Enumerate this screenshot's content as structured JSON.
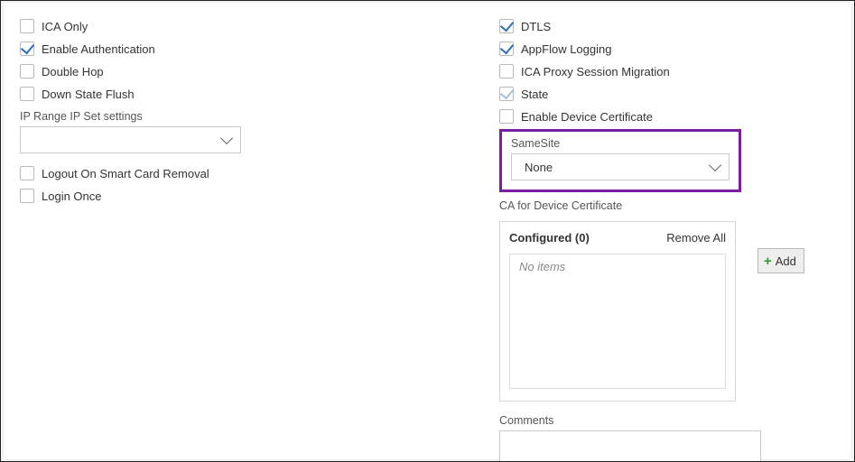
{
  "left": {
    "ica_only": "ICA Only",
    "enable_auth": "Enable Authentication",
    "double_hop": "Double Hop",
    "down_state_flush": "Down State Flush",
    "ip_range_label": "IP Range IP Set settings",
    "ip_range_value": "",
    "logout_smart": "Logout On Smart Card Removal",
    "login_once": "Login Once"
  },
  "right": {
    "dtls": "DTLS",
    "appflow": "AppFlow Logging",
    "ica_proxy": "ICA Proxy Session Migration",
    "state": "State",
    "enable_device_cert": "Enable Device Certificate",
    "samesite_label": "SameSite",
    "samesite_value": "None",
    "ca_label": "CA for Device Certificate",
    "configured_label": "Configured (0)",
    "remove_all": "Remove All",
    "no_items": "No items",
    "add_label": "Add",
    "comments_label": "Comments",
    "comments_value": ""
  }
}
